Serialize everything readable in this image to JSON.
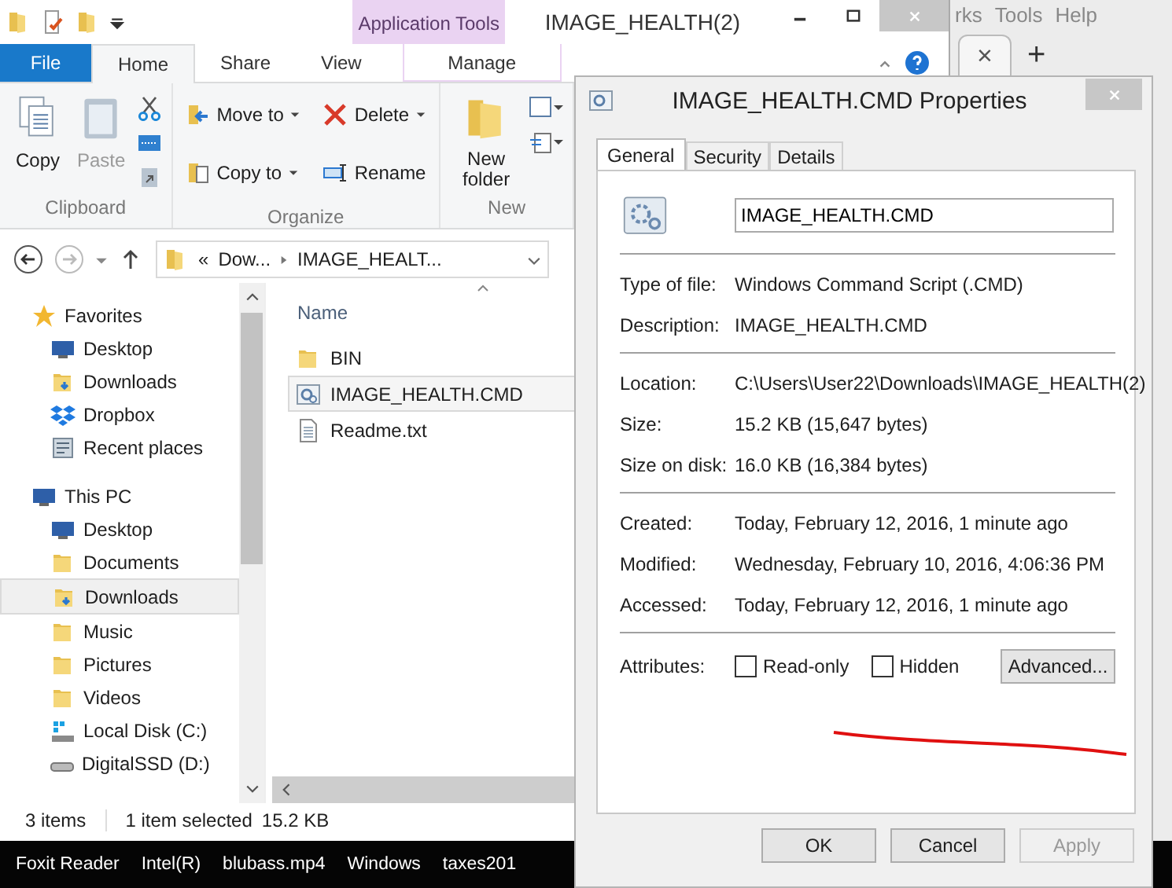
{
  "explorer": {
    "title": "IMAGE_HEALTH(2)",
    "context_group": "Application Tools",
    "ribbon_tabs": [
      {
        "label": "File",
        "kind": "file",
        "selected": false
      },
      {
        "label": "Home",
        "kind": "tab",
        "selected": true
      },
      {
        "label": "Share",
        "kind": "tab",
        "selected": false
      },
      {
        "label": "View",
        "kind": "tab",
        "selected": false
      },
      {
        "label": "Manage",
        "kind": "context",
        "selected": false
      }
    ],
    "ribbon": {
      "copy": "Copy",
      "paste": {
        "label": "Paste",
        "disabled": true
      },
      "clipboard": "Clipboard",
      "move_to": "Move to",
      "copy_to": "Copy to",
      "delete": "Delete",
      "rename": "Rename",
      "organize": "Organize",
      "new_folder": "New folder",
      "new": "New"
    },
    "address": {
      "overflow_mark": "«",
      "segments": [
        "Dow...",
        "IMAGE_HEALT..."
      ]
    },
    "nav": [
      {
        "label": "Favorites",
        "kind": "star",
        "selected": false,
        "children": [
          {
            "label": "Desktop",
            "kind": "desktop",
            "selected": false
          },
          {
            "label": "Downloads",
            "kind": "downloads",
            "selected": false
          },
          {
            "label": "Dropbox",
            "kind": "dropbox",
            "selected": false
          },
          {
            "label": "Recent places",
            "kind": "recent",
            "selected": false
          }
        ]
      },
      {
        "label": "This PC",
        "kind": "pc",
        "selected": false,
        "children": [
          {
            "label": "Desktop",
            "kind": "desktop",
            "selected": false
          },
          {
            "label": "Documents",
            "kind": "folder",
            "selected": false
          },
          {
            "label": "Downloads",
            "kind": "downloads",
            "selected": true
          },
          {
            "label": "Music",
            "kind": "folder",
            "selected": false
          },
          {
            "label": "Pictures",
            "kind": "folder",
            "selected": false
          },
          {
            "label": "Videos",
            "kind": "folder",
            "selected": false
          },
          {
            "label": "Local Disk (C:)",
            "kind": "drive",
            "selected": false
          },
          {
            "label": "DigitalSSD (D:)",
            "kind": "disk",
            "selected": false
          }
        ]
      }
    ],
    "column": "Name",
    "files": [
      {
        "name": "BIN",
        "kind": "folder",
        "selected": false
      },
      {
        "name": "IMAGE_HEALTH.CMD",
        "kind": "script",
        "selected": true
      },
      {
        "name": "Readme.txt",
        "kind": "text",
        "selected": false
      }
    ],
    "status": [
      "3 items",
      "1 item selected",
      "15.2 KB"
    ]
  },
  "browser": {
    "menu": [
      "rks",
      "Tools",
      "Help"
    ],
    "tab_close": "×",
    "new_tab": "+"
  },
  "taskbar": [
    "Foxit Reader",
    "Intel(R)",
    "blubass.mp4",
    "Windows",
    "taxes201"
  ],
  "dialog": {
    "title": "IMAGE_HEALTH.CMD Properties",
    "tabs": [
      {
        "label": "General",
        "selected": true
      },
      {
        "label": "Security",
        "selected": false
      },
      {
        "label": "Details",
        "selected": false
      }
    ],
    "file_name": "IMAGE_HEALTH.CMD",
    "sections": [
      [
        {
          "label": "Type of file:",
          "value": "Windows Command Script (.CMD)"
        },
        {
          "label": "Description:",
          "value": "IMAGE_HEALTH.CMD"
        }
      ],
      [
        {
          "label": "Location:",
          "value": "C:\\Users\\User22\\Downloads\\IMAGE_HEALTH(2)"
        },
        {
          "label": "Size:",
          "value": "15.2 KB (15,647 bytes)"
        },
        {
          "label": "Size on disk:",
          "value": "16.0 KB (16,384 bytes)"
        }
      ],
      [
        {
          "label": "Created:",
          "value": "Today, February 12, 2016, 1 minute ago"
        },
        {
          "label": "Modified:",
          "value": "Wednesday, February 10, 2016, 4:06:36 PM"
        },
        {
          "label": "Accessed:",
          "value": "Today, February 12, 2016, 1 minute ago"
        }
      ]
    ],
    "attributes_label": "Attributes:",
    "attributes": [
      {
        "label": "Read-only",
        "checked": false
      },
      {
        "label": "Hidden",
        "checked": false
      }
    ],
    "advanced": "Advanced...",
    "buttons": [
      {
        "label": "OK",
        "disabled": false
      },
      {
        "label": "Cancel",
        "disabled": false
      },
      {
        "label": "Apply",
        "disabled": true
      }
    ]
  }
}
